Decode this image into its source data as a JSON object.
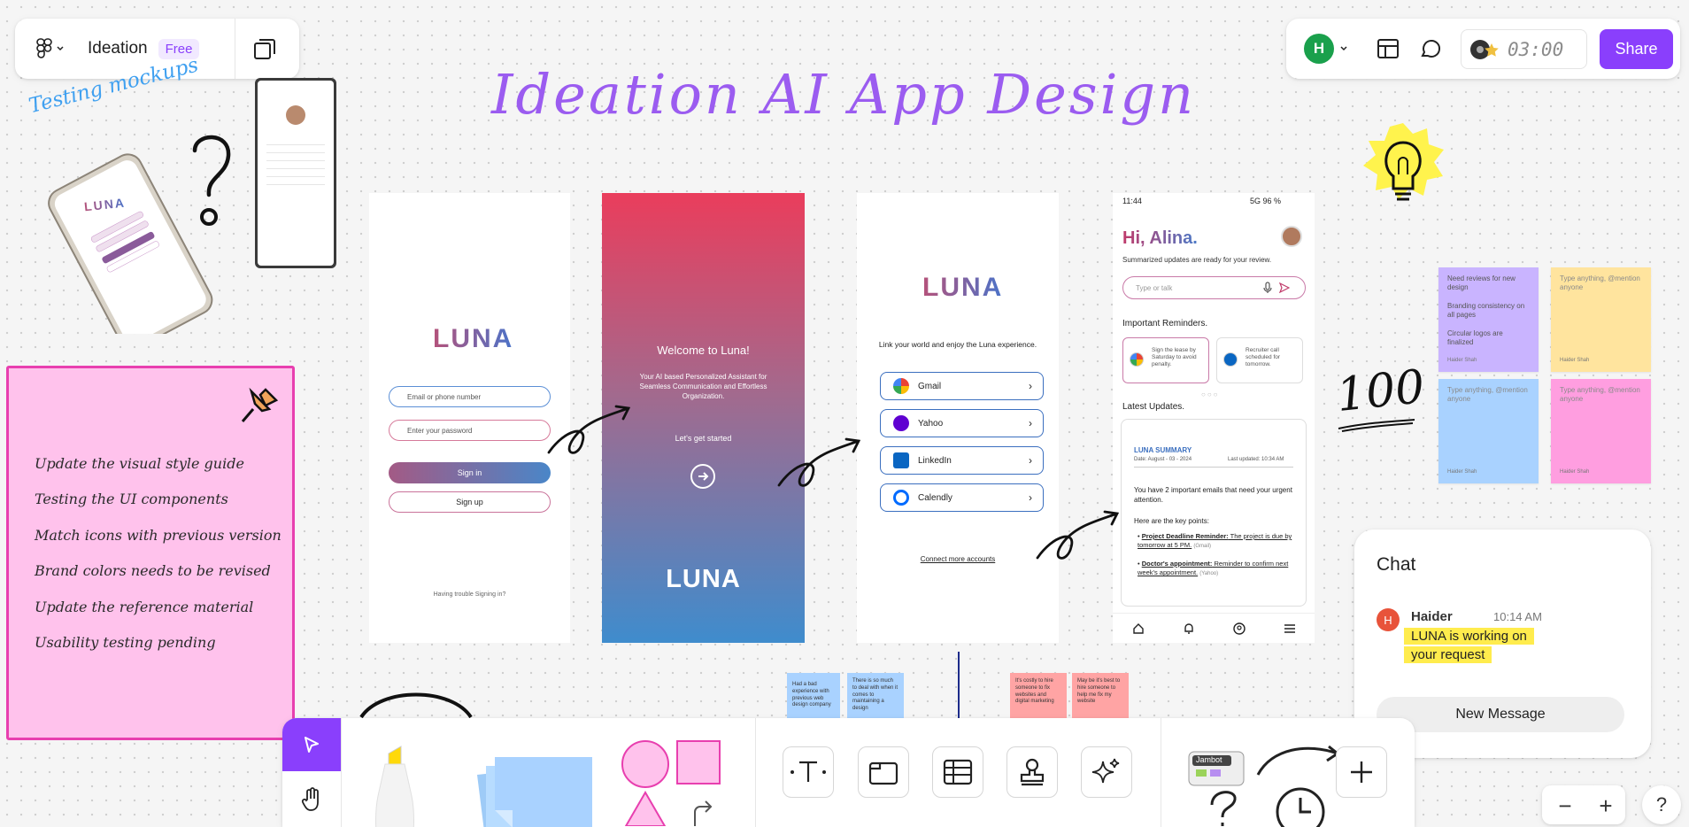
{
  "file": {
    "name": "Ideation",
    "plan_badge": "Free"
  },
  "header": {
    "timer": "03:00",
    "share_label": "Share",
    "user_initial": "H"
  },
  "board_title": "Ideation AI App Design",
  "testing_label": "Testing mockups",
  "hundred_label": "100",
  "pink_note": {
    "items": [
      "Update the visual style guide",
      "Testing the UI components",
      "Match icons with previous version",
      "Brand colors needs to be revised",
      "Update the reference material",
      "Usability testing pending"
    ]
  },
  "screen_login": {
    "logo": "LUNA",
    "email_placeholder": "Email or phone number",
    "password_placeholder": "Enter your password",
    "signin": "Sign in",
    "signup": "Sign up",
    "trouble": "Having trouble Signing in?"
  },
  "screen_welcome": {
    "title": "Welcome to Luna!",
    "subtitle": "Your AI based Personalized Assistant for Seamless Communication and Effortless Organization.",
    "cta": "Let's get started",
    "logo": "LUNA"
  },
  "screen_link": {
    "logo": "LUNA",
    "tagline": "Link your world and enjoy the Luna experience.",
    "accounts": [
      "Gmail",
      "Yahoo",
      "LinkedIn",
      "Calendly"
    ],
    "connect_more": "Connect more accounts"
  },
  "screen_home": {
    "status_time": "11:44",
    "status_right": "5G 96 %",
    "greeting": "Hi, Alina.",
    "summary_line": "Summarized updates are ready for your review.",
    "search_placeholder": "Type or talk",
    "reminders_heading": "Important Reminders.",
    "reminders": [
      "Sign the lease by Saturday to avoid penalty.",
      "Recruiter call scheduled for tomorrow."
    ],
    "updates_heading": "Latest Updates.",
    "summary_title": "LUNA SUMMARY",
    "summary_date": "Date: August - 03 - 2024",
    "summary_updated": "Last updated: 10:34 AM",
    "summary_body": "You have 2 important emails that need your urgent attention.",
    "key_points_label": "Here are the key points:",
    "points": [
      {
        "bold": "Project Deadline Reminder:",
        "text": " The project is due by tomorrow at 5 PM.",
        "src": "(Gmail)"
      },
      {
        "bold": "Doctor's appointment:",
        "text": " Reminder to confirm next week's appointment.",
        "src": "(Yahoo)"
      }
    ]
  },
  "stickies": [
    {
      "text": [
        "Need reviews for new design",
        "Branding consistency on all pages",
        "Circular logos are finalized"
      ],
      "author": "Haider Shah",
      "color": "#c9b4ff"
    },
    {
      "text": [
        "Type anything, @mention anyone"
      ],
      "author": "Haider Shah",
      "color": "#ffe49e"
    },
    {
      "text": [
        "Type anything, @mention anyone"
      ],
      "author": "Haider Shah",
      "color": "#a9d2ff"
    },
    {
      "text": [
        "Type anything, @mention anyone"
      ],
      "author": "Haider Shah",
      "color": "#ff9ee0"
    }
  ],
  "bottom_stickies": [
    "Had a bad experience with previous web design company",
    "There is so much to deal with when it comes to maintaining a design",
    "It's costly to hire someone to fix websites and digital marketing",
    "May be it's best to hire someone to help me fix my website"
  ],
  "chat": {
    "title": "Chat",
    "user": "Haider",
    "user_initial": "H",
    "time": "10:14 AM",
    "message": "LUNA is working on your request",
    "new_message": "New Message"
  },
  "stickers": {
    "jambot": "Jambot"
  },
  "zoom": {
    "out": "−",
    "in": "+",
    "help": "?"
  }
}
